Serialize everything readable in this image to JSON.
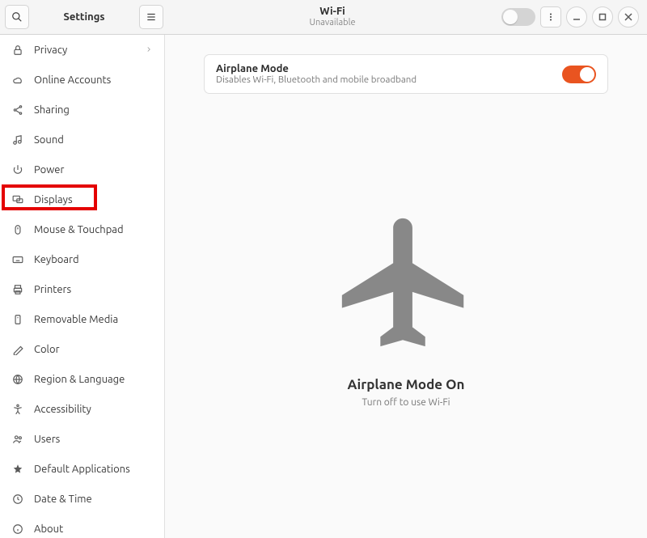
{
  "header": {
    "sidebar_title": "Settings",
    "page_title": "Wi-Fi",
    "page_subtitle": "Unavailable"
  },
  "sidebar": {
    "items": [
      {
        "icon": "lock",
        "label": "Privacy",
        "has_chevron": true
      },
      {
        "icon": "cloud",
        "label": "Online Accounts"
      },
      {
        "icon": "share",
        "label": "Sharing"
      },
      {
        "icon": "sound",
        "label": "Sound"
      },
      {
        "icon": "power",
        "label": "Power"
      },
      {
        "icon": "displays",
        "label": "Displays",
        "highlighted": true
      },
      {
        "icon": "mouse",
        "label": "Mouse & Touchpad"
      },
      {
        "icon": "keyboard",
        "label": "Keyboard"
      },
      {
        "icon": "printer",
        "label": "Printers"
      },
      {
        "icon": "removable",
        "label": "Removable Media"
      },
      {
        "icon": "color",
        "label": "Color"
      },
      {
        "icon": "region",
        "label": "Region & Language"
      },
      {
        "icon": "accessibility",
        "label": "Accessibility"
      },
      {
        "icon": "users",
        "label": "Users"
      },
      {
        "icon": "defaults",
        "label": "Default Applications"
      },
      {
        "icon": "datetime",
        "label": "Date & Time"
      },
      {
        "icon": "about",
        "label": "About"
      }
    ]
  },
  "airplane_card": {
    "title": "Airplane Mode",
    "subtitle": "Disables Wi-Fi, Bluetooth and mobile broadband",
    "enabled": true
  },
  "placeholder": {
    "title": "Airplane Mode On",
    "subtitle": "Turn off to use Wi-Fi"
  }
}
